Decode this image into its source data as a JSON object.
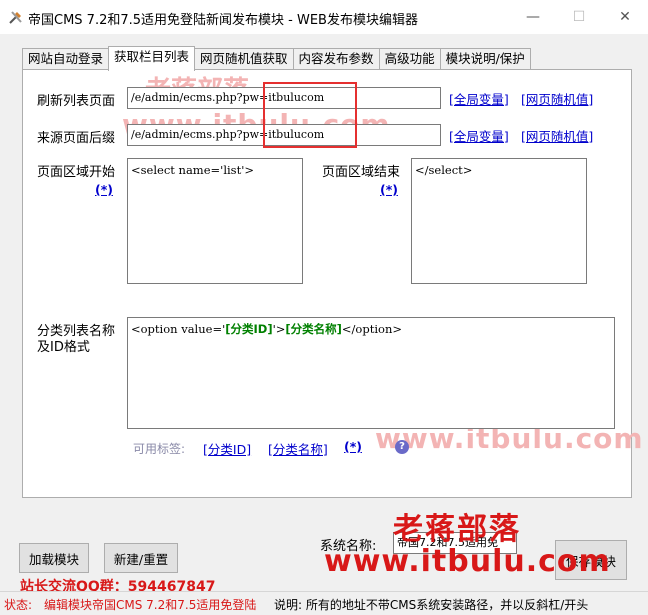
{
  "window": {
    "title": "帝国CMS 7.2和7.5适用免登陆新闻发布模块 - WEB发布模块编辑器",
    "minimize": "—",
    "maximize": "☐",
    "close": "✕"
  },
  "tabs": [
    {
      "label": "网站自动登录"
    },
    {
      "label": "获取栏目列表"
    },
    {
      "label": "网页随机值获取"
    },
    {
      "label": "内容发布参数"
    },
    {
      "label": "高级功能"
    },
    {
      "label": "模块说明/保护"
    }
  ],
  "form": {
    "refresh_label": "刷新列表页面",
    "refresh_value": "/e/admin/ecms.php?pw=itbulucom",
    "source_label": "来源页面后缀",
    "source_value": "/e/admin/ecms.php?pw=itbulucom",
    "global_var_link": "[全局变量]",
    "random_value_link": "[网页随机值]",
    "region_start_label": "页面区域开始",
    "region_start_value": "<select name='list'>",
    "region_end_label": "页面区域结束",
    "region_end_value": "</select>",
    "star_link": "(*)",
    "category_label_line1": "分类列表名称",
    "category_label_line2": "及ID格式",
    "category_prefix": "<option value='",
    "category_id_tag": "[分类ID]",
    "category_mid": "'>",
    "category_name_tag": "[分类名称]",
    "category_suffix": "</option>",
    "available_tags_label": "可用标签:",
    "tag_id_link": "[分类ID]",
    "tag_name_link": "[分类名称]",
    "tag_star_link": "(*)",
    "help_icon": "?"
  },
  "bottom": {
    "load_button": "加载模块",
    "new_button": "新建/重置",
    "system_name_label": "系统名称:",
    "system_name_value": "帝国7.2和7.5适用免",
    "save_button": "保存模块"
  },
  "watermarks": {
    "small_cn": "老蒋部落",
    "small_url": "www.itbulu.com",
    "big_cn": "老蒋部落",
    "big_url": "www.itbulu.com",
    "qq_group": "站长交流QQ群：594467847"
  },
  "status_bar": {
    "label": "状态:",
    "message": "编辑模块帝国CMS 7.2和7.5适用免登陆",
    "hint": "说明:  所有的地址不带CMS系统安装路径，并以反斜杠/开头"
  },
  "colors": {
    "link": "#0000cc",
    "tag_green": "#008000",
    "highlight_box": "#e53030",
    "watermark_red": "#d81818"
  }
}
